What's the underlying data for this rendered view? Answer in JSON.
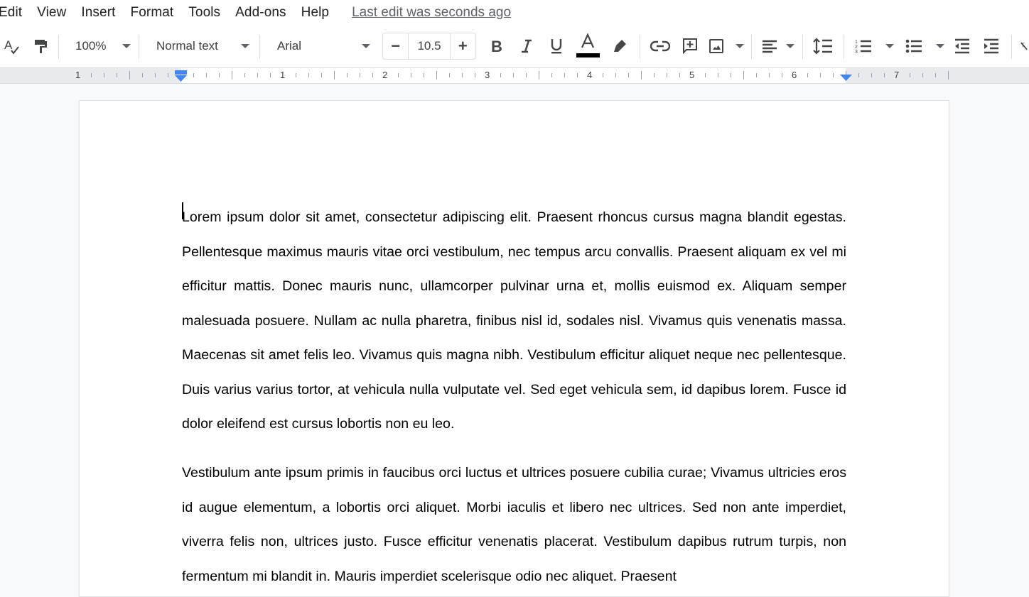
{
  "menubar": {
    "items": [
      "Edit",
      "View",
      "Insert",
      "Format",
      "Tools",
      "Add-ons",
      "Help"
    ],
    "last_edit": "Last edit was seconds ago"
  },
  "toolbar": {
    "spellcheck_icon": "spellcheck-icon",
    "paint_format_icon": "paint-format-icon",
    "zoom": "100%",
    "style": "Normal text",
    "font": "Arial",
    "font_size": "10.5",
    "decrease_label": "−",
    "increase_label": "+",
    "text_color": "#000000",
    "icons": [
      "bold-icon",
      "italic-icon",
      "underline-icon",
      "text-color-icon",
      "highlight-icon",
      "link-icon",
      "add-comment-icon",
      "insert-image-icon",
      "align-left-icon",
      "line-spacing-icon",
      "numbered-list-icon",
      "bulleted-list-icon",
      "decrease-indent-icon",
      "increase-indent-icon",
      "clear-formatting-icon"
    ]
  },
  "ruler": {
    "labels": [
      "1",
      "1",
      "2",
      "3",
      "4",
      "5",
      "6",
      "7"
    ],
    "accent_color": "#4285f4"
  },
  "document": {
    "paragraphs": [
      "Lorem ipsum dolor sit amet, consectetur adipiscing elit. Praesent rhoncus cursus magna blandit egestas. Pellentesque maximus mauris vitae orci vestibulum, nec tempus arcu convallis. Praesent aliquam ex vel mi efficitur mattis. Donec mauris nunc, ullamcorper pulvinar urna et, mollis euismod ex. Aliquam semper malesuada posuere. Nullam ac nulla pharetra, finibus nisl id, sodales nisl. Vivamus quis venenatis massa. Maecenas sit amet felis leo. Vivamus quis magna nibh. Vestibulum efficitur aliquet neque nec pellentesque. Duis varius varius tortor, at vehicula nulla vulputate vel. Sed eget vehicula sem, id dapibus lorem. Fusce id dolor eleifend est cursus lobortis non eu leo.",
      "Vestibulum ante ipsum primis in faucibus orci luctus et ultrices posuere cubilia curae; Vivamus ultricies eros id augue elementum, a lobortis orci aliquet. Morbi iaculis et libero nec ultrices. Sed non ante imperdiet, viverra felis non, ultrices justo. Fusce efficitur venenatis placerat. Vestibulum dapibus rutrum turpis, non fermentum mi blandit in. Mauris imperdiet scelerisque odio nec aliquet. Praesent"
    ]
  }
}
